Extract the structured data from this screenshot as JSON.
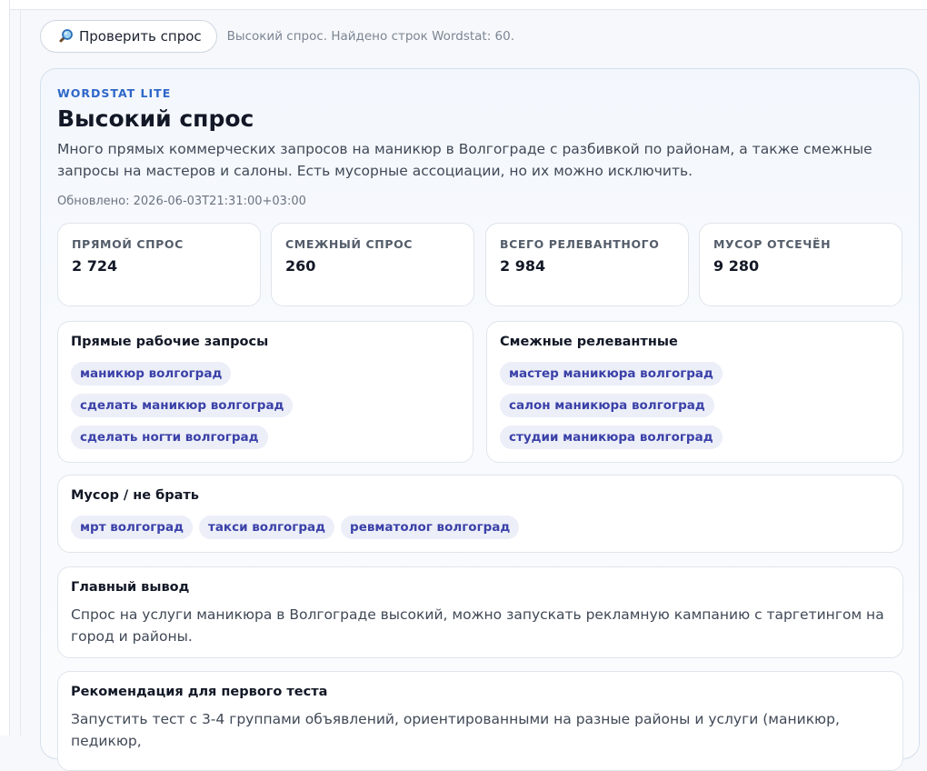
{
  "toolbar": {
    "check_button_label": "Проверить спрос",
    "status_text": "Высокий спрос. Найдено строк Wordstat: 60."
  },
  "report": {
    "eyebrow": "WORDSTAT LITE",
    "title": "Высокий спрос",
    "description": "Много прямых коммерческих запросов на маникюр в Волгограде с разбивкой по районам, а также смежные запросы на мастеров и салоны. Есть мусорные ассоциации, но их можно исключить.",
    "updated": "Обновлено: 2026-06-03T21:31:00+03:00"
  },
  "metrics": [
    {
      "label": "ПРЯМОЙ СПРОС",
      "value": "2 724"
    },
    {
      "label": "СМЕЖНЫЙ СПРОС",
      "value": "260"
    },
    {
      "label": "ВСЕГО РЕЛЕВАНТНОГО",
      "value": "2 984"
    },
    {
      "label": "МУСОР ОТСЕЧЁН",
      "value": "9 280"
    }
  ],
  "direct_queries": {
    "title": "Прямые рабочие запросы",
    "chips": [
      "маникюр волгоград",
      "сделать маникюр волгоград",
      "сделать ногти волгоград"
    ]
  },
  "related_queries": {
    "title": "Смежные релевантные",
    "chips": [
      "мастер маникюра волгоград",
      "салон маникюра волгоград",
      "студии маникюра волгоград"
    ]
  },
  "junk_queries": {
    "title": "Мусор / не брать",
    "chips": [
      "мрт волгоград",
      "такси волгоград",
      "ревматолог волгоград"
    ]
  },
  "main_conclusion": {
    "title": "Главный вывод",
    "text": "Спрос на услуги маникюра в Волгограде высокий, можно запускать рекламную кампанию с таргетингом на город и районы."
  },
  "first_test": {
    "title": "Рекомендация для первого теста",
    "text": "Запустить тест с 3-4 группами объявлений, ориентированными на разные районы и услуги (маникюр, педикюр, "
  },
  "colors": {
    "accent": "#2f67c8",
    "chip_bg": "#eceef8",
    "chip_text": "#3a41a8"
  },
  "icons": {
    "check_button": "magnifier-icon"
  }
}
